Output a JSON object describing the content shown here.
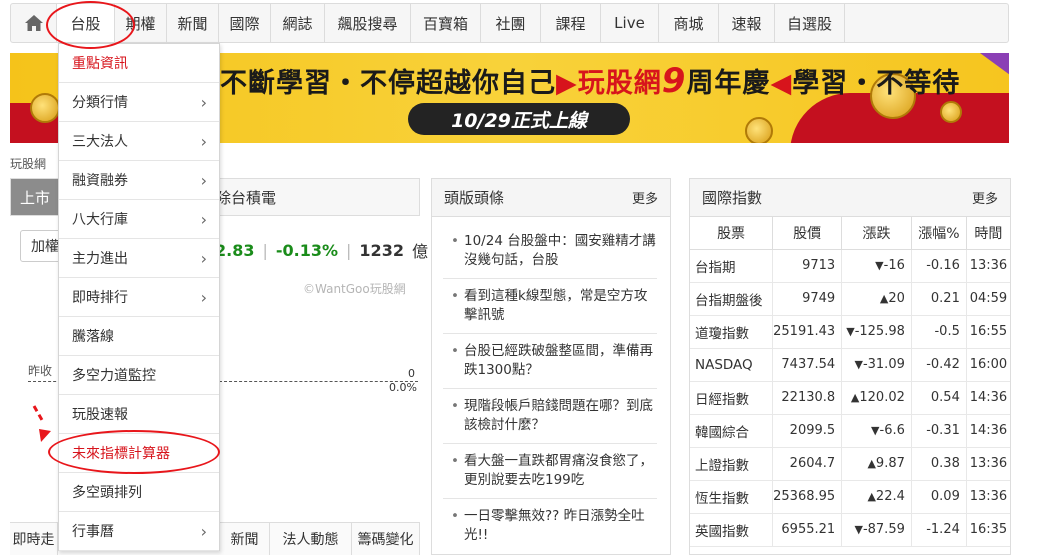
{
  "nav": {
    "home_icon": "home-icon",
    "items": [
      "台股",
      "期權",
      "新聞",
      "國際",
      "網誌",
      "飆股搜尋",
      "百寶箱",
      "社團",
      "課程",
      "Live",
      "商城",
      "速報",
      "自選股"
    ]
  },
  "banner": {
    "slogan_part1": "不斷學習・不停超越你自己",
    "slogan_part2": "▶玩股網",
    "slogan_nine": "9",
    "slogan_part3": "周年慶",
    "slogan_part4": "◀",
    "slogan_part5": "學習・不等待",
    "date_text": "10/29正式上線"
  },
  "breadcrumb": "玩股網",
  "left_panel": {
    "tab_active": "上市",
    "tab_exclude": "除台積電",
    "add_button": "加權",
    "quote_value": "2.83",
    "quote_change_pct": "-0.13%",
    "quote_volume": "1232",
    "quote_unit": "億",
    "watermark": "©WantGoo玩股網",
    "prev_close_label": "昨收",
    "zero_value": "0",
    "zero_pct": "0.0%",
    "bottom_tabs": [
      "即時走",
      "新聞",
      "法人動態",
      "籌碼變化"
    ]
  },
  "dropdown": {
    "items": [
      {
        "label": "重點資訊",
        "arrow": false,
        "red": true
      },
      {
        "label": "分類行情",
        "arrow": true,
        "red": false
      },
      {
        "label": "三大法人",
        "arrow": true,
        "red": false
      },
      {
        "label": "融資融券",
        "arrow": true,
        "red": false
      },
      {
        "label": "八大行庫",
        "arrow": true,
        "red": false
      },
      {
        "label": "主力進出",
        "arrow": true,
        "red": false
      },
      {
        "label": "即時排行",
        "arrow": true,
        "red": false
      },
      {
        "label": "騰落線",
        "arrow": false,
        "red": false
      },
      {
        "label": "多空力道監控",
        "arrow": false,
        "red": false
      },
      {
        "label": "玩股速報",
        "arrow": false,
        "red": false
      },
      {
        "label": "未來指標計算器",
        "arrow": false,
        "red": true
      },
      {
        "label": "多空頭排列",
        "arrow": false,
        "red": false
      },
      {
        "label": "行事曆",
        "arrow": true,
        "red": false
      }
    ],
    "arrow_glyph": "›"
  },
  "news": {
    "title": "頭版頭條",
    "more": "更多",
    "items": [
      "10/24 台股盤中：國安雞精才講沒幾句話，台股",
      "看到這種k線型態，常是空方攻擊訊號",
      "台股已經跌破盤整區間，準備再跌1300點？",
      "現階段帳戶賠錢問題在哪？到底該檢討什麼？",
      "看大盤一直跌都胃痛沒食慾了，更別說要去吃199吃",
      "一日零擊無效?? 昨日漲勢全吐光!!"
    ]
  },
  "indices": {
    "title": "國際指數",
    "more": "更多",
    "headers": [
      "股票",
      "股價",
      "漲跌",
      "漲幅%",
      "時間"
    ],
    "rows": [
      {
        "name": "台指期",
        "price": "9713",
        "change": "-16",
        "pct": "-0.16",
        "time": "13:36",
        "dir": "down"
      },
      {
        "name": "台指期盤後",
        "price": "9749",
        "change": "20",
        "pct": "0.21",
        "time": "04:59",
        "dir": "up"
      },
      {
        "name": "道瓊指數",
        "price": "25191.43",
        "change": "-125.98",
        "pct": "-0.5",
        "time": "16:55",
        "dir": "down"
      },
      {
        "name": "NASDAQ",
        "price": "7437.54",
        "change": "-31.09",
        "pct": "-0.42",
        "time": "16:00",
        "dir": "down"
      },
      {
        "name": "日經指數",
        "price": "22130.8",
        "change": "120.02",
        "pct": "0.54",
        "time": "14:36",
        "dir": "up"
      },
      {
        "name": "韓國綜合",
        "price": "2099.5",
        "change": "-6.6",
        "pct": "-0.31",
        "time": "14:36",
        "dir": "down"
      },
      {
        "name": "上證指數",
        "price": "2604.7",
        "change": "9.87",
        "pct": "0.38",
        "time": "13:36",
        "dir": "up"
      },
      {
        "name": "恆生指數",
        "price": "25368.95",
        "change": "22.4",
        "pct": "0.09",
        "time": "13:36",
        "dir": "up"
      },
      {
        "name": "英國指數",
        "price": "6955.21",
        "change": "-87.59",
        "pct": "-1.24",
        "time": "16:35",
        "dir": "down"
      }
    ]
  },
  "colors": {
    "accent_red": "#d7141c",
    "down_green": "#1a8c1a",
    "banner_yellow": "#f5c31a"
  }
}
